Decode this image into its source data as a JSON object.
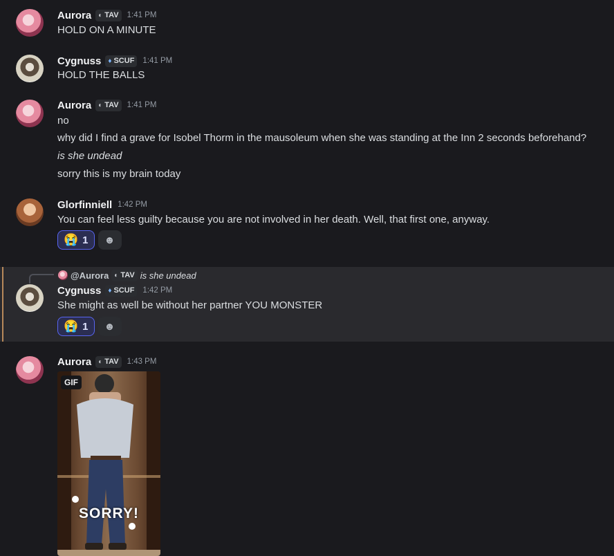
{
  "messages": [
    {
      "author": "Aurora",
      "tag": "TAV",
      "time": "1:41 PM",
      "lines": [
        "HOLD ON A MINUTE"
      ]
    },
    {
      "author": "Cygnuss",
      "tag": "SCUF",
      "time": "1:41 PM",
      "lines": [
        "HOLD THE BALLS"
      ]
    },
    {
      "author": "Aurora",
      "tag": "TAV",
      "time": "1:41 PM",
      "lines": [
        "no",
        "why did I find a grave for Isobel Thorm in the mausoleum when she was standing at the Inn 2 seconds beforehand?",
        "is she undead",
        "sorry this is my brain today"
      ]
    },
    {
      "author": "Glorfinniell",
      "time": "1:42 PM",
      "lines": [
        "You can feel less guilty because you are not involved in her death. Well, that first one, anyway."
      ],
      "reaction": {
        "emoji": "😭",
        "count": "1"
      }
    },
    {
      "reply": {
        "author": "@Aurora",
        "tag": "TAV",
        "text": "is she undead"
      },
      "author": "Cygnuss",
      "tag": "SCUF",
      "time": "1:42 PM",
      "lines": [
        "She might as well be without her partner YOU MONSTER"
      ],
      "reaction": {
        "emoji": "😭",
        "count": "1"
      }
    },
    {
      "author": "Aurora",
      "tag": "TAV",
      "time": "1:43 PM",
      "gif": {
        "badge": "GIF",
        "caption": "SORRY!"
      }
    }
  ],
  "icons": {
    "tav_tag": "crescent-icon",
    "scuf_tag": "drop-icon",
    "add_reaction": "smile-add-icon"
  },
  "colors": {
    "background": "#1a1a1e",
    "highlight": "#2a2a2e",
    "highlight_bar": "#b8895a",
    "reaction_active_border": "#5865f2"
  }
}
